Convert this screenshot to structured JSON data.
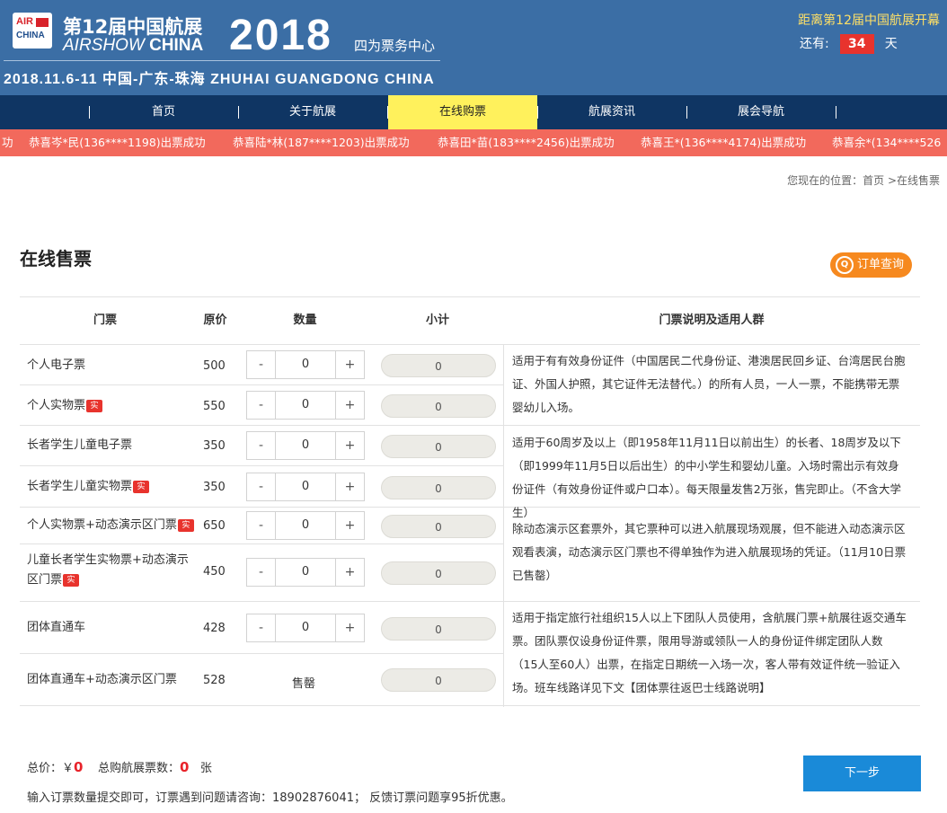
{
  "header": {
    "logo_line1": "AIR",
    "logo_line2": "CHINA",
    "title_cn": "第12届中国航展",
    "title_en_1": "AIRSHOW ",
    "title_en_2": "CHINA",
    "year": "2018",
    "center": "四为票务中心",
    "date_line": "2018.11.6-11 中国-广东-珠海 ZHUHAI GUANGDONG CHINA",
    "countdown_title": "距离第12届中国航展开幕",
    "countdown_prefix": "还有:",
    "countdown_days": "34",
    "countdown_unit": "天"
  },
  "nav": {
    "items": [
      {
        "label": "首页"
      },
      {
        "label": "关于航展"
      },
      {
        "label": "在线购票"
      },
      {
        "label": "航展资讯"
      },
      {
        "label": "展会导航"
      }
    ]
  },
  "ticker": {
    "items": [
      "功",
      "恭喜岑*民(136****1198)出票成功",
      "恭喜陆*林(187****1203)出票成功",
      "恭喜田*苗(183****2456)出票成功",
      "恭喜王*(136****4174)出票成功",
      "恭喜余*(134****526"
    ]
  },
  "breadcrumb": "您现在的位置：首页 >在线售票",
  "page_title": "在线售票",
  "order_query": {
    "label": "订单查询",
    "icon": "Q"
  },
  "table": {
    "headers": [
      "门票",
      "原价",
      "数量",
      "小计",
      "门票说明及适用人群"
    ],
    "rows": [
      {
        "name": "个人电子票",
        "price": "500",
        "qty": "0",
        "subtotal": "0",
        "tag": false
      },
      {
        "name": "个人实物票",
        "price": "550",
        "qty": "0",
        "subtotal": "0",
        "tag": true
      },
      {
        "name": "长者学生儿童电子票",
        "price": "350",
        "qty": "0",
        "subtotal": "0",
        "tag": false
      },
      {
        "name": "长者学生儿童实物票",
        "price": "350",
        "qty": "0",
        "subtotal": "0",
        "tag": true
      },
      {
        "name": "个人实物票+动态演示区门票",
        "price": "650",
        "qty": "0",
        "subtotal": "0",
        "tag": true
      },
      {
        "name": "儿童长者学生实物票+动态演示区门票",
        "price": "450",
        "qty": "0",
        "subtotal": "0",
        "tag": true
      },
      {
        "name": "团体直通车",
        "price": "428",
        "qty": "0",
        "subtotal": "0",
        "tag": false
      },
      {
        "name": "团体直通车+动态演示区门票",
        "price": "528",
        "qty": "售罄",
        "subtotal": "0",
        "tag": false
      }
    ],
    "tag_label": "实",
    "minus_label": "-",
    "plus_label": "+",
    "descriptions": [
      "适用于有有效身份证件（中国居民二代身份证、港澳居民回乡证、台湾居民台胞证、外国人护照，其它证件无法替代。）的所有人员，一人一票，不能携带无票婴幼儿入场。",
      "适用于60周岁及以上（即1958年11月11日以前出生）的长者、18周岁及以下（即1999年11月5日以后出生）的中小学生和婴幼儿童。入场时需出示有效身份证件（有效身份证件或户口本）。每天限量发售2万张，售完即止。（不含大学生）",
      "除动态演示区套票外，其它票种可以进入航展现场观展，但不能进入动态演示区观看表演，动态演示区门票也不得单独作为进入航展现场的凭证。（11月10日票已售罄）",
      "适用于指定旅行社组织15人以上下团队人员使用，含航展门票+航展往返交通车票。团队票仅设身份证件票，限用导游或领队一人的身份证件绑定团队人数（15人至60人）出票，在指定日期统一入场一次，客人带有效证件统一验证入场。班车线路详见下文【团体票往返巴士线路说明】"
    ]
  },
  "footer": {
    "total_label": "总价：￥",
    "total_value": "0",
    "count_label": "总购航展票数：",
    "count_value": "0",
    "count_unit": "张",
    "notice": "输入订票数量提交即可，订票遇到问题请咨询：18902876041； 反馈订票问题享95折优惠。",
    "next_label": "下一步"
  }
}
